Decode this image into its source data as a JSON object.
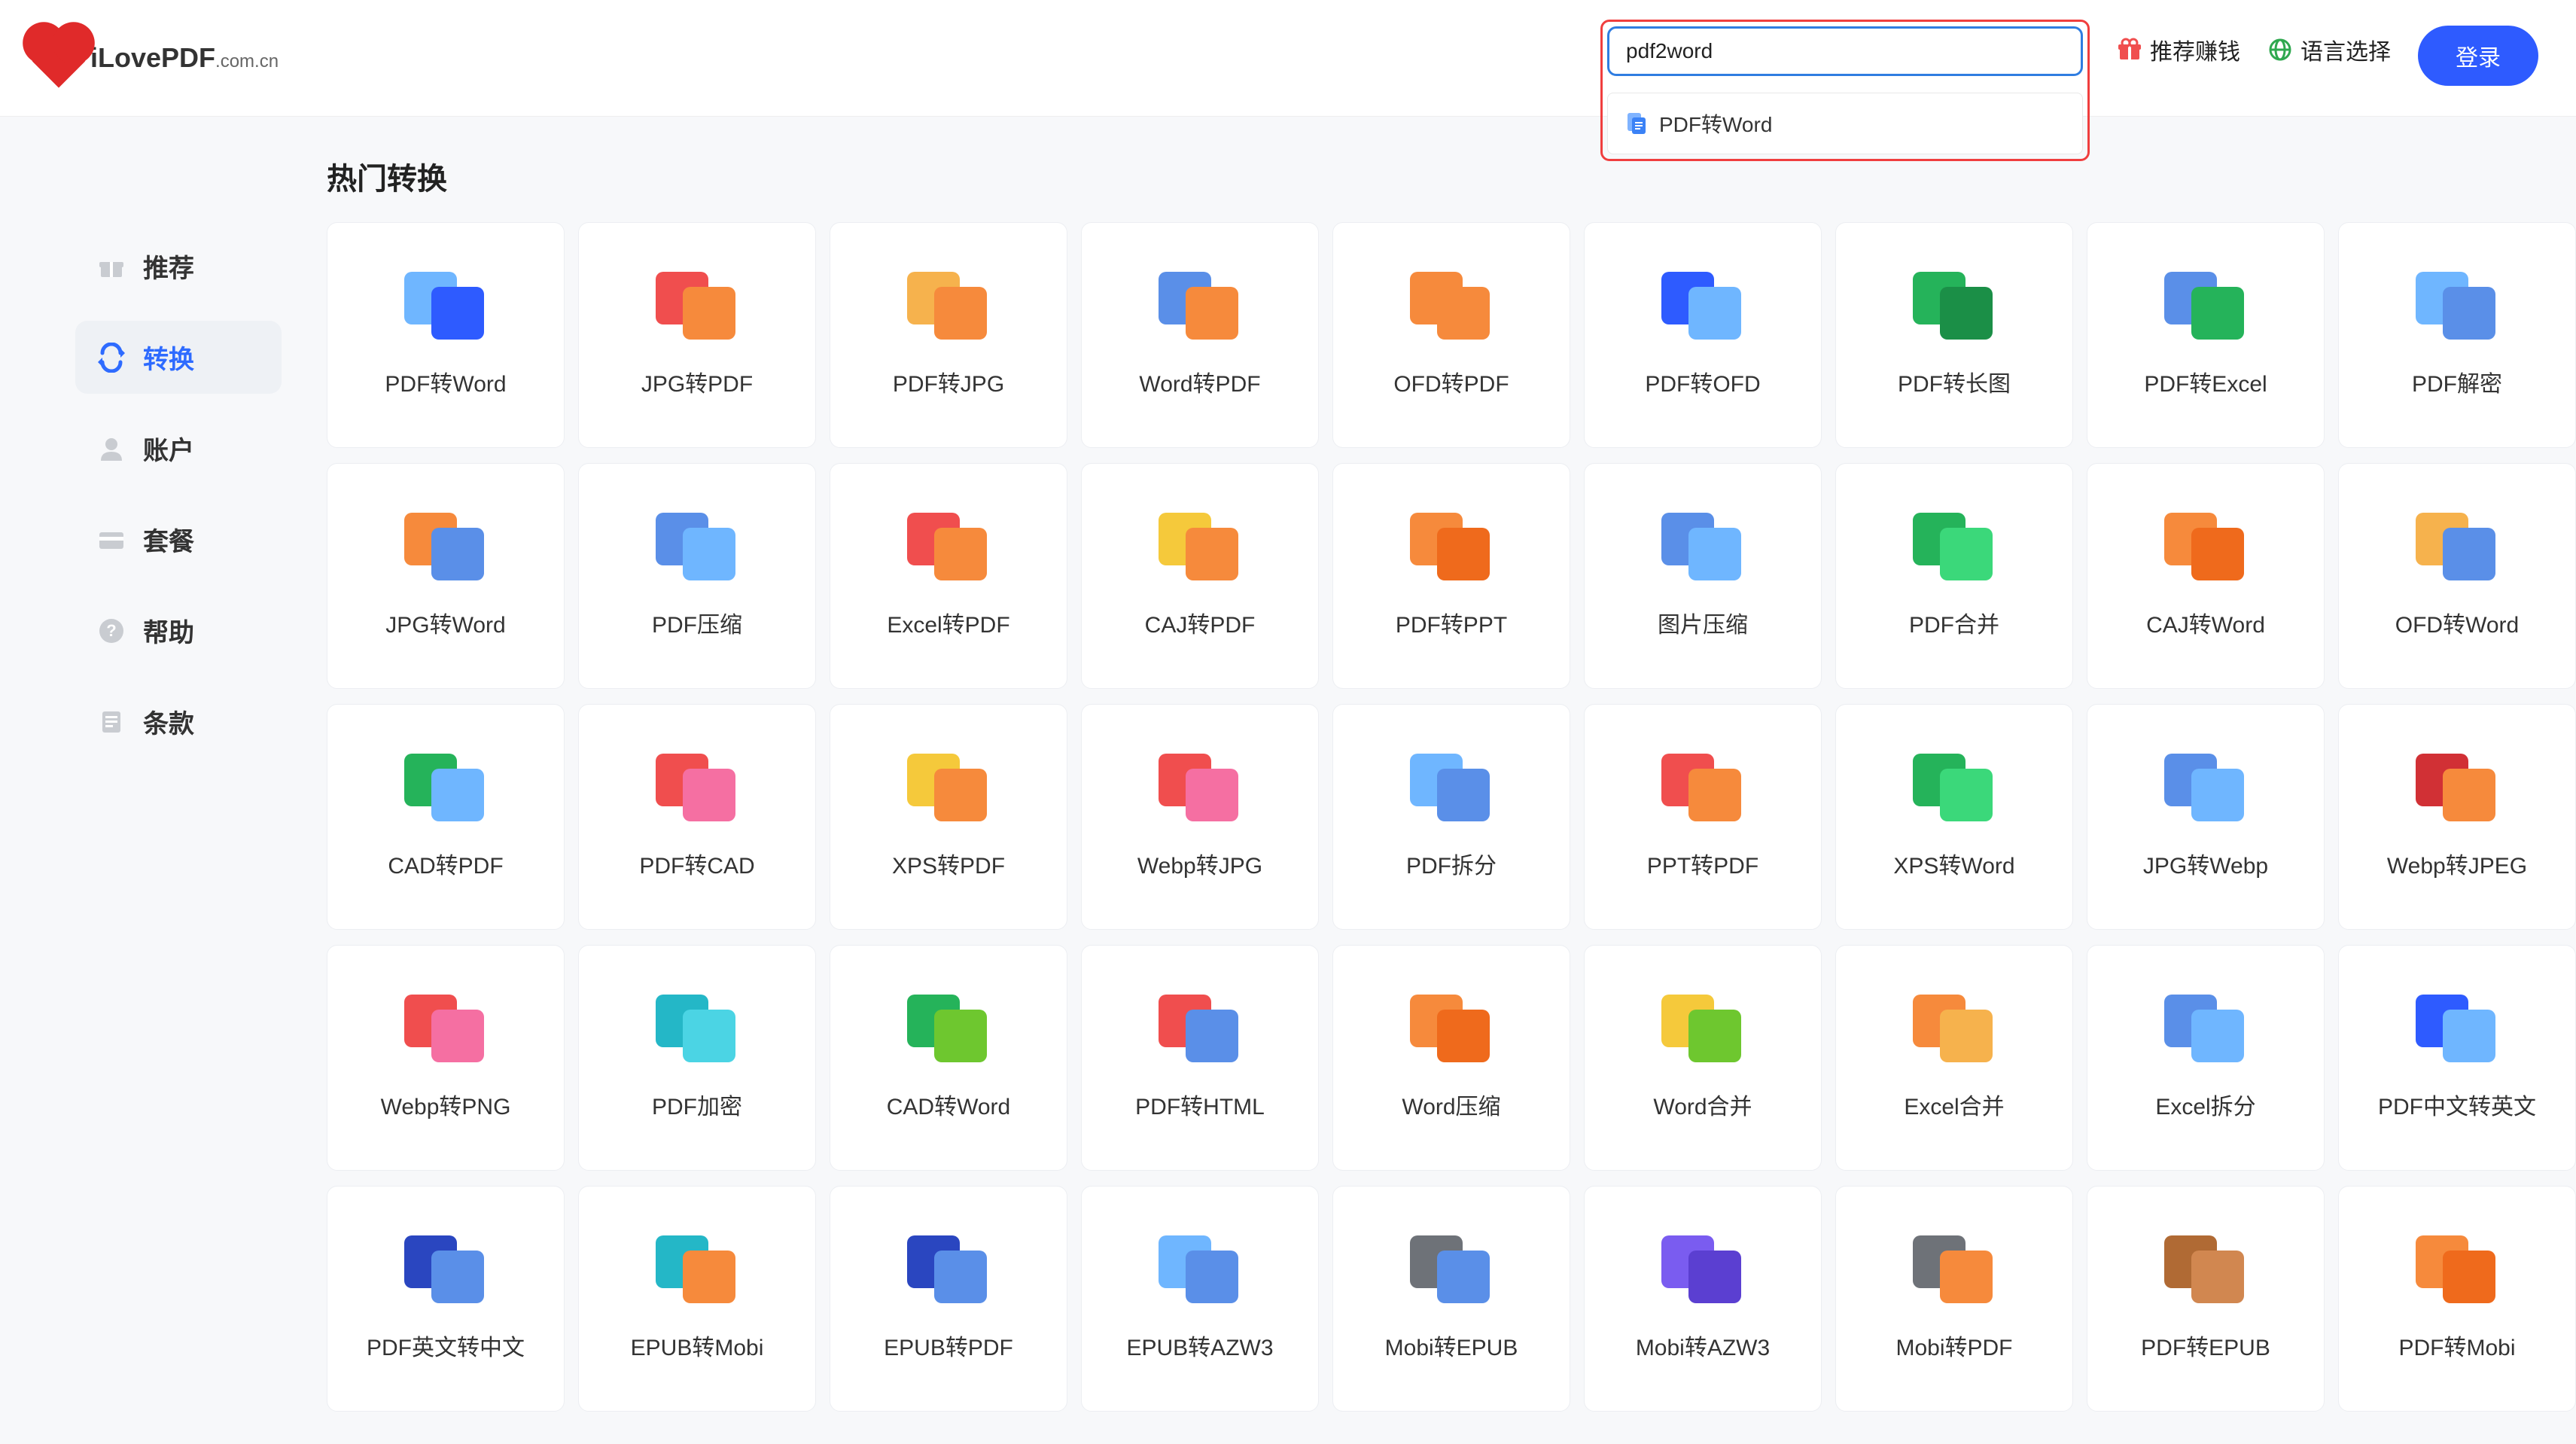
{
  "header": {
    "logo_main": "iLovePDF",
    "logo_suffix": ".com.cn",
    "search_value": "pdf2word",
    "search_suggestion": "PDF转Word",
    "link_recommend": "推荐赚钱",
    "link_language": "语言选择",
    "login_label": "登录"
  },
  "sidebar": {
    "items": [
      {
        "label": "推荐"
      },
      {
        "label": "转换"
      },
      {
        "label": "账户"
      },
      {
        "label": "套餐"
      },
      {
        "label": "帮助"
      },
      {
        "label": "条款"
      }
    ]
  },
  "main": {
    "section_title": "热门转换",
    "tools": [
      {
        "label": "PDF转Word",
        "back": "bg-lblue",
        "front": "bg-blue2"
      },
      {
        "label": "JPG转PDF",
        "back": "bg-red",
        "front": "bg-orange"
      },
      {
        "label": "PDF转JPG",
        "back": "bg-lorange",
        "front": "bg-orange"
      },
      {
        "label": "Word转PDF",
        "back": "bg-blue",
        "front": "bg-orange"
      },
      {
        "label": "OFD转PDF",
        "back": "bg-orange",
        "front": "bg-orange"
      },
      {
        "label": "PDF转OFD",
        "back": "bg-blue2",
        "front": "bg-lblue"
      },
      {
        "label": "PDF转长图",
        "back": "bg-green",
        "front": "bg-dgreen"
      },
      {
        "label": "PDF转Excel",
        "back": "bg-blue",
        "front": "bg-green"
      },
      {
        "label": "PDF解密",
        "back": "bg-lblue",
        "front": "bg-blue"
      },
      {
        "label": "JPG转Word",
        "back": "bg-orange",
        "front": "bg-blue"
      },
      {
        "label": "PDF压缩",
        "back": "bg-blue",
        "front": "bg-lblue"
      },
      {
        "label": "Excel转PDF",
        "back": "bg-red",
        "front": "bg-orange"
      },
      {
        "label": "CAJ转PDF",
        "back": "bg-yellow",
        "front": "bg-orange"
      },
      {
        "label": "PDF转PPT",
        "back": "bg-orange",
        "front": "bg-dorange"
      },
      {
        "label": "图片压缩",
        "back": "bg-blue",
        "front": "bg-lblue"
      },
      {
        "label": "PDF合并",
        "back": "bg-green",
        "front": "bg-lgreen"
      },
      {
        "label": "CAJ转Word",
        "back": "bg-orange",
        "front": "bg-dorange"
      },
      {
        "label": "OFD转Word",
        "back": "bg-lorange",
        "front": "bg-blue"
      },
      {
        "label": "CAD转PDF",
        "back": "bg-green",
        "front": "bg-lblue"
      },
      {
        "label": "PDF转CAD",
        "back": "bg-red",
        "front": "bg-pink"
      },
      {
        "label": "XPS转PDF",
        "back": "bg-yellow",
        "front": "bg-orange"
      },
      {
        "label": "Webp转JPG",
        "back": "bg-red",
        "front": "bg-pink"
      },
      {
        "label": "PDF拆分",
        "back": "bg-lblue",
        "front": "bg-blue"
      },
      {
        "label": "PPT转PDF",
        "back": "bg-red",
        "front": "bg-orange"
      },
      {
        "label": "XPS转Word",
        "back": "bg-green",
        "front": "bg-lgreen"
      },
      {
        "label": "JPG转Webp",
        "back": "bg-blue",
        "front": "bg-lblue"
      },
      {
        "label": "Webp转JPEG",
        "back": "bg-dred",
        "front": "bg-orange"
      },
      {
        "label": "Webp转PNG",
        "back": "bg-red",
        "front": "bg-pink"
      },
      {
        "label": "PDF加密",
        "back": "bg-teal",
        "front": "bg-cyan"
      },
      {
        "label": "CAD转Word",
        "back": "bg-green",
        "front": "bg-lime"
      },
      {
        "label": "PDF转HTML",
        "back": "bg-red",
        "front": "bg-blue"
      },
      {
        "label": "Word压缩",
        "back": "bg-orange",
        "front": "bg-dorange"
      },
      {
        "label": "Word合并",
        "back": "bg-yellow",
        "front": "bg-lime"
      },
      {
        "label": "Excel合并",
        "back": "bg-orange",
        "front": "bg-lorange"
      },
      {
        "label": "Excel拆分",
        "back": "bg-blue",
        "front": "bg-lblue"
      },
      {
        "label": "PDF中文转英文",
        "back": "bg-blue2",
        "front": "bg-lblue"
      },
      {
        "label": "PDF英文转中文",
        "back": "bg-deepblue",
        "front": "bg-blue"
      },
      {
        "label": "EPUB转Mobi",
        "back": "bg-teal",
        "front": "bg-orange"
      },
      {
        "label": "EPUB转PDF",
        "back": "bg-deepblue",
        "front": "bg-blue"
      },
      {
        "label": "EPUB转AZW3",
        "back": "bg-lblue",
        "front": "bg-blue"
      },
      {
        "label": "Mobi转EPUB",
        "back": "bg-gray",
        "front": "bg-blue"
      },
      {
        "label": "Mobi转AZW3",
        "back": "bg-purple",
        "front": "bg-dpurple"
      },
      {
        "label": "Mobi转PDF",
        "back": "bg-gray",
        "front": "bg-orange"
      },
      {
        "label": "PDF转EPUB",
        "back": "bg-brown",
        "front": "bg-lbrown"
      },
      {
        "label": "PDF转Mobi",
        "back": "bg-orange",
        "front": "bg-dorange"
      }
    ]
  }
}
